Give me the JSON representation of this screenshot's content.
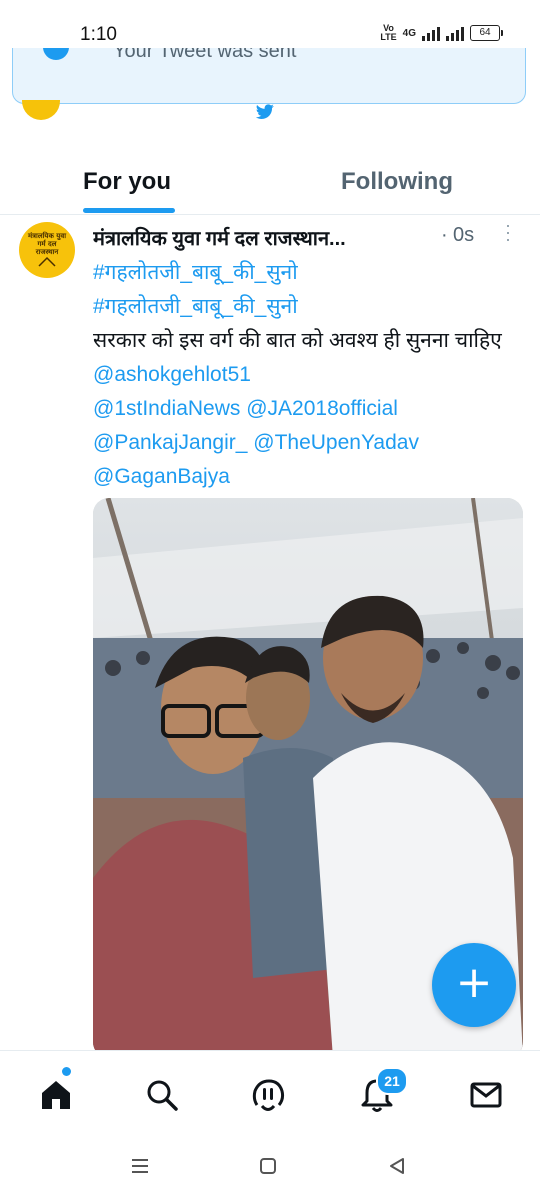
{
  "status_bar": {
    "time": "1:10",
    "volte": "Vo\nLTE",
    "network": "4G",
    "battery": "64"
  },
  "toast": {
    "text": "Your Tweet was sent"
  },
  "tabs": [
    {
      "label": "For you"
    },
    {
      "label": "Following"
    }
  ],
  "tweet": {
    "author": "मंत्रालयिक युवा गर्म दल राजस्थान...",
    "separator": "·",
    "time_ago": "0s",
    "avatar_text": "मंत्रालयिक युवा गर्म दल राजस्थान",
    "hashtag1": "#गहलोतजी_बाबू_की_सुनो",
    "hashtag2": "#गहलोतजी_बाबू_की_सुनो",
    "text": "सरकार को इस वर्ग की बात को अवश्य ही सुनना चाहिए",
    "mention1": "@ashokgehlot51",
    "mention2": "@1stIndiaNews",
    "mention3": "@JA2018official",
    "mention4": "@PankajJangir_",
    "mention5": "@TheUpenYadav",
    "mention6": "@GaganBajya"
  },
  "fab": {
    "icon": "plus-icon",
    "label": "+"
  },
  "bottom_nav": {
    "notifications_badge": "21",
    "items": [
      "home-icon",
      "search-icon",
      "spaces-icon",
      "bell-icon",
      "mail-icon"
    ]
  },
  "colors": {
    "accent": "#1d9bf0",
    "text": "#0f1419",
    "muted": "#536471"
  }
}
